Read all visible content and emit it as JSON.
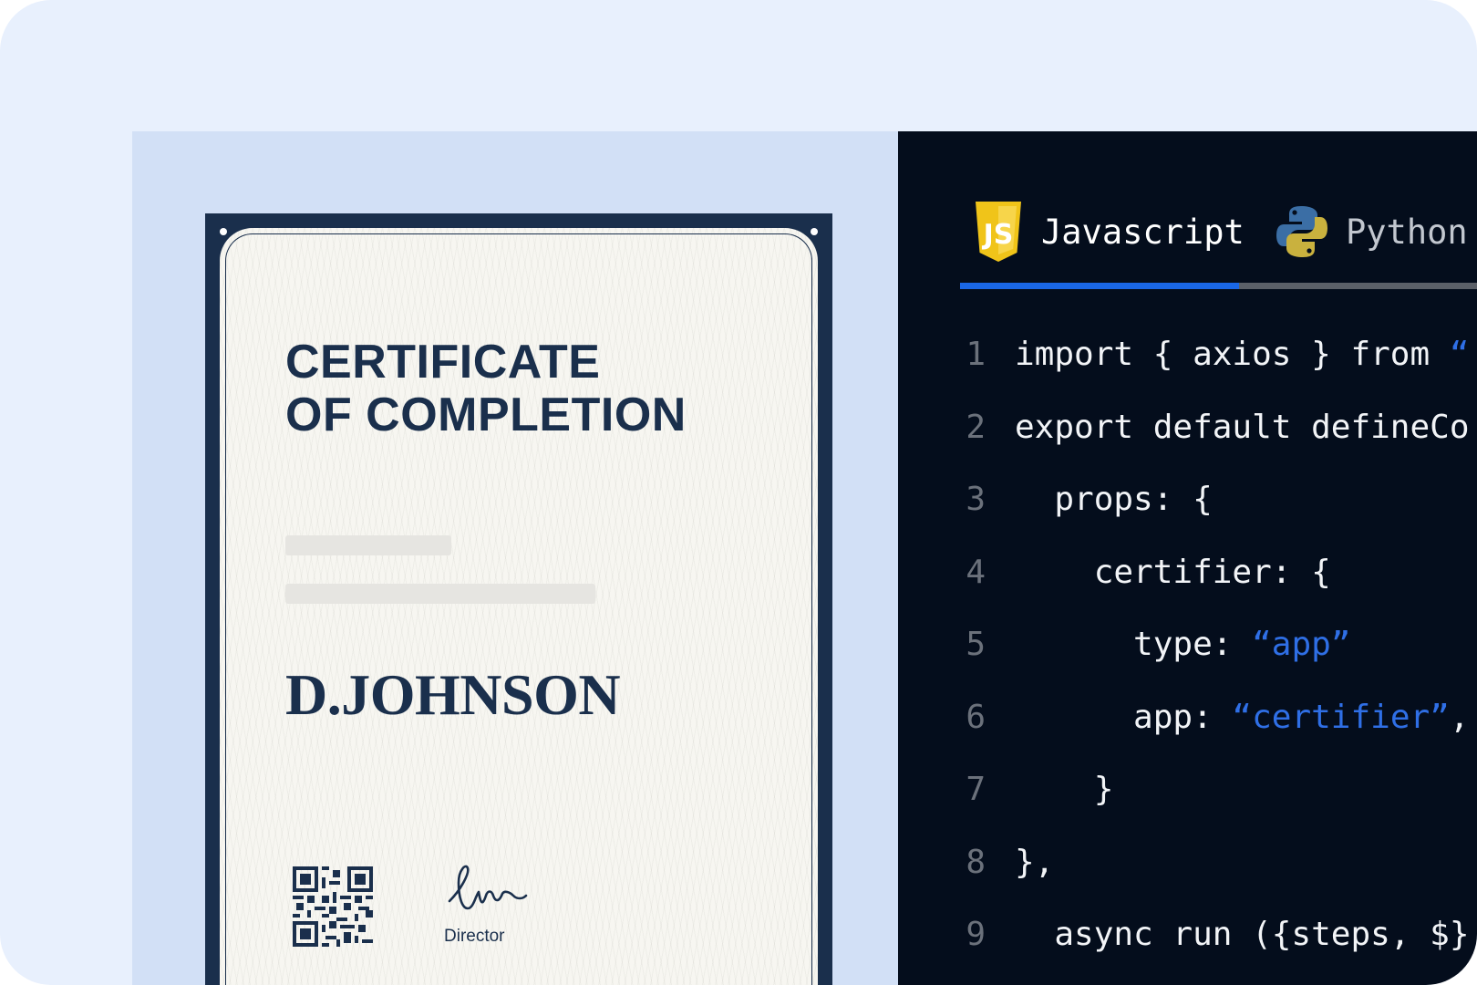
{
  "certificate": {
    "title_line1": "CERTIFICATE",
    "title_line2": "OF COMPLETION",
    "recipient": "D.JOHNSON",
    "signer_title": "Director"
  },
  "code_editor": {
    "tabs": [
      {
        "label": "Javascript",
        "icon": "javascript-logo-icon",
        "active": true
      },
      {
        "label": "Python",
        "icon": "python-logo-icon",
        "active": false
      }
    ],
    "lines": [
      {
        "number": "1",
        "segments": [
          {
            "text": "import { axios } from ",
            "string": false
          },
          {
            "text": "“",
            "string": true
          }
        ]
      },
      {
        "number": "2",
        "segments": [
          {
            "text": "export default defineCo",
            "string": false
          }
        ]
      },
      {
        "number": "3",
        "segments": [
          {
            "text": "  props: {",
            "string": false
          }
        ]
      },
      {
        "number": "4",
        "segments": [
          {
            "text": "    certifier: {",
            "string": false
          }
        ]
      },
      {
        "number": "5",
        "segments": [
          {
            "text": "      type: ",
            "string": false
          },
          {
            "text": "“app”",
            "string": true
          }
        ]
      },
      {
        "number": "6",
        "segments": [
          {
            "text": "      app: ",
            "string": false
          },
          {
            "text": "“certifier”",
            "string": true
          },
          {
            "text": ",",
            "string": false
          }
        ]
      },
      {
        "number": "7",
        "segments": [
          {
            "text": "    }",
            "string": false
          }
        ]
      },
      {
        "number": "8",
        "segments": [
          {
            "text": "},",
            "string": false
          }
        ]
      },
      {
        "number": "9",
        "segments": [
          {
            "text": "  async run ({steps, $}",
            "string": false
          }
        ]
      }
    ]
  },
  "colors": {
    "page_background": "#e8f0fd",
    "certificate_panel": "#d2e0f6",
    "certificate_navy": "#1a2f4c",
    "code_background": "#040d1c",
    "code_string": "#2f6fe6",
    "active_tab_accent": "#1a67e6",
    "javascript_logo": "#f0c419",
    "python_blue": "#3b6ea5",
    "python_yellow": "#c9b13e"
  }
}
